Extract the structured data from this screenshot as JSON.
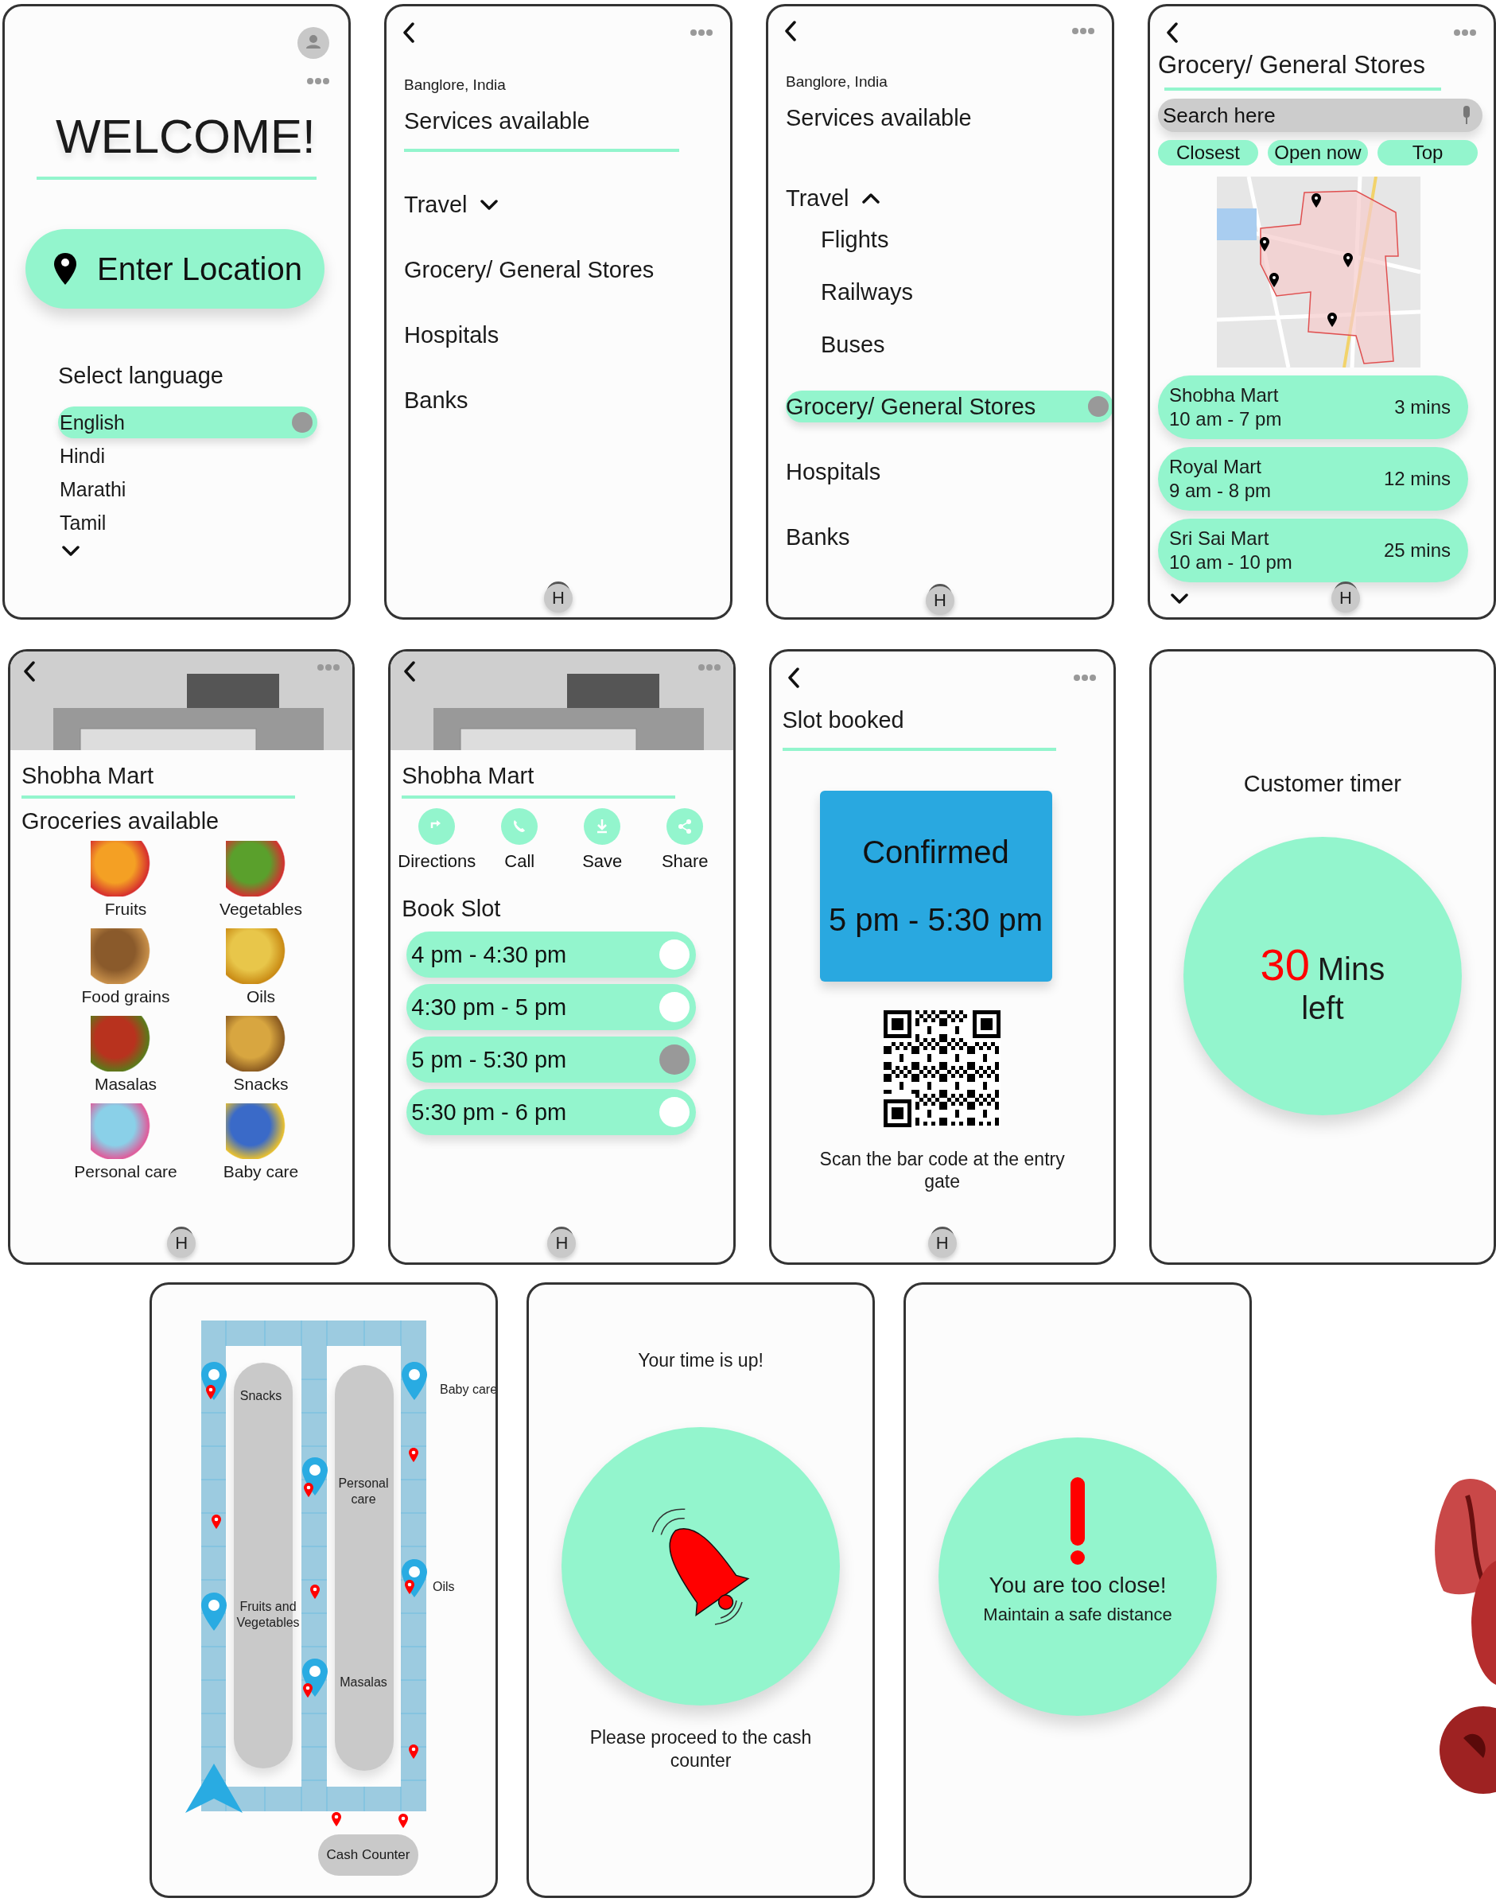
{
  "screens": [
    {
      "kind": "welcome",
      "title": "WELCOME!",
      "button": "Enter Location",
      "language_label": "Select language",
      "languages": [
        {
          "label": "English",
          "selected": true
        },
        {
          "label": "Hindi",
          "selected": false
        },
        {
          "label": "Marathi",
          "selected": false
        },
        {
          "label": "Tamil",
          "selected": false
        }
      ]
    },
    {
      "kind": "services",
      "location": "Banglore, India",
      "heading": "Services available",
      "items": [
        {
          "kind": "group",
          "label": "Travel",
          "expanded": false,
          "selected": false
        },
        {
          "kind": "link",
          "label": "Grocery/ General Stores",
          "selected": false
        },
        {
          "kind": "link",
          "label": "Hospitals",
          "selected": false
        },
        {
          "kind": "link",
          "label": "Banks",
          "selected": false
        }
      ],
      "home": "H"
    },
    {
      "kind": "services",
      "location": "Banglore, India",
      "heading": "Services available",
      "items": [
        {
          "kind": "group",
          "label": "Travel",
          "expanded": true,
          "selected": false,
          "children": [
            {
              "label": "Flights",
              "selected": false
            },
            {
              "label": "Railways",
              "selected": false
            },
            {
              "label": "Buses",
              "selected": false
            }
          ]
        },
        {
          "kind": "link",
          "label": "Grocery/ General Stores",
          "selected": true
        },
        {
          "kind": "link",
          "label": "Hospitals",
          "selected": false
        },
        {
          "kind": "link",
          "label": "Banks",
          "selected": false
        }
      ],
      "home": "H"
    },
    {
      "kind": "stores",
      "heading": "Grocery/ General Stores",
      "search": {
        "placeholder": "Search here"
      },
      "filters": [
        "Closest",
        "Open now",
        "Top"
      ],
      "stores": [
        {
          "name": "Shobha Mart",
          "hours": "10 am - 7 pm",
          "distance": "3 mins"
        },
        {
          "name": "Royal Mart",
          "hours": "9 am - 8 pm",
          "distance": "12 mins"
        },
        {
          "name": "Sri Sai Mart",
          "hours": "10 am - 10 pm",
          "distance": "25 mins"
        }
      ],
      "home": "H"
    },
    {
      "kind": "store_detail",
      "name": "Shobha Mart",
      "heading": "Groceries available",
      "categories": [
        "Fruits",
        "Vegetables",
        "Food grains",
        "Oils",
        "Masalas",
        "Snacks",
        "Personal care",
        "Baby care"
      ],
      "home": "H"
    },
    {
      "kind": "booking",
      "name": "Shobha Mart",
      "actions": [
        "Directions",
        "Call",
        "Save",
        "Share"
      ],
      "heading": "Book Slot",
      "slots": [
        {
          "label": "4 pm - 4:30 pm",
          "selected": false
        },
        {
          "label": "4:30 pm - 5 pm",
          "selected": false
        },
        {
          "label": "5 pm - 5:30 pm",
          "selected": true
        },
        {
          "label": "5:30 pm - 6 pm",
          "selected": false
        }
      ],
      "home": "H"
    },
    {
      "kind": "confirmed",
      "heading": "Slot booked",
      "status": "Confirmed",
      "time": "5 pm - 5:30 pm",
      "caption": "Scan the bar code at the entry gate",
      "home": "H"
    },
    {
      "kind": "timer",
      "heading": "Customer timer",
      "value": "30",
      "unit": "Mins",
      "rest": "left"
    },
    {
      "kind": "store_map",
      "sections": [
        "Snacks",
        "Personal care",
        "Fruits and Vegetables",
        "Masalas",
        "Baby care",
        "Oils"
      ],
      "counter": "Cash Counter"
    },
    {
      "kind": "time_up",
      "heading": "Your time is up!",
      "caption": "Please proceed to the cash counter"
    },
    {
      "kind": "too_close",
      "title": "You are too close!",
      "subtitle": "Maintain a safe distance"
    }
  ]
}
